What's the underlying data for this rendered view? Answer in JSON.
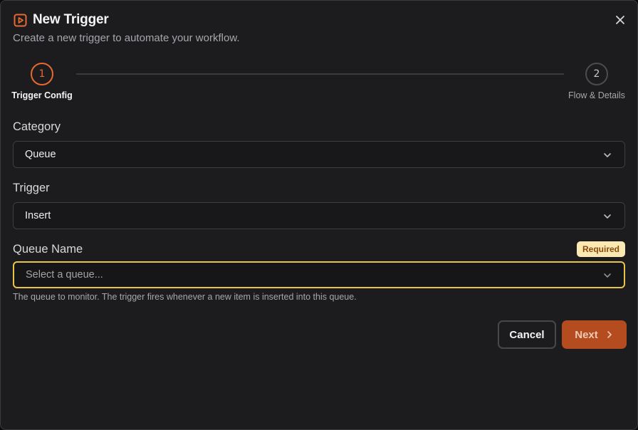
{
  "dialog": {
    "title": "New Trigger",
    "subtitle": "Create a new trigger to automate your workflow."
  },
  "stepper": {
    "steps": [
      {
        "number": "1",
        "label": "Trigger Config",
        "state": "active"
      },
      {
        "number": "2",
        "label": "Flow & Details",
        "state": "inactive"
      }
    ]
  },
  "form": {
    "category": {
      "label": "Category",
      "value": "Queue"
    },
    "trigger": {
      "label": "Trigger",
      "value": "Insert"
    },
    "queue_name": {
      "label": "Queue Name",
      "badge": "Required",
      "placeholder": "Select a queue...",
      "help": "The queue to monitor. The trigger fires whenever a new item is inserted into this queue."
    }
  },
  "actions": {
    "cancel": "Cancel",
    "next": "Next"
  },
  "colors": {
    "accent": "#e8692f",
    "warning_border": "#e8c547",
    "badge_bg": "#fbe9b4",
    "next_bg": "#b54c1f"
  },
  "icons": {
    "title": "play-square-icon",
    "close": "close-icon",
    "select": "chevron-down-icon",
    "next": "chevron-right-icon"
  }
}
